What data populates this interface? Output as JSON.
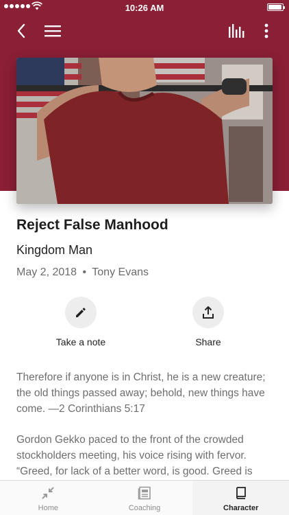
{
  "status_bar": {
    "time": "10:26 AM",
    "battery_level": 0.95
  },
  "nav": {
    "back_icon": "chevron-left-icon",
    "menu_icon": "hamburger-menu-icon",
    "stats_icon": "bar-chart-icon",
    "more_icon": "more-vertical-icon"
  },
  "colors": {
    "header_background": "#8a1f36",
    "muted_text": "#6e6e6e",
    "action_circle": "#ededed"
  },
  "article": {
    "title": "Reject False Manhood",
    "series": "Kingdom Man",
    "date": "May 2, 2018",
    "separator": "•",
    "author": "Tony Evans",
    "hero_image": "man-in-red-shirt-with-barbell-photo"
  },
  "actions": {
    "note_label": "Take a note",
    "note_icon": "pencil-icon",
    "share_label": "Share",
    "share_icon": "share-upload-icon"
  },
  "body": {
    "paragraph_1": "Therefore if anyone is in Christ, he is a new creature; the old things passed away; behold, new things have come. —2 Corinthians 5:17",
    "paragraph_2": "Gordon Gekko paced to the front of the crowded stockholders meeting, his voice rising with fervor. “Greed, for lack of a better word, is good. Greed is"
  },
  "tabbar": {
    "home_label": "Home",
    "home_icon": "collapse-arrows-icon",
    "coaching_label": "Coaching",
    "coaching_icon": "newspaper-icon",
    "character_label": "Character",
    "character_icon": "book-icon",
    "active_tab": "Character"
  }
}
